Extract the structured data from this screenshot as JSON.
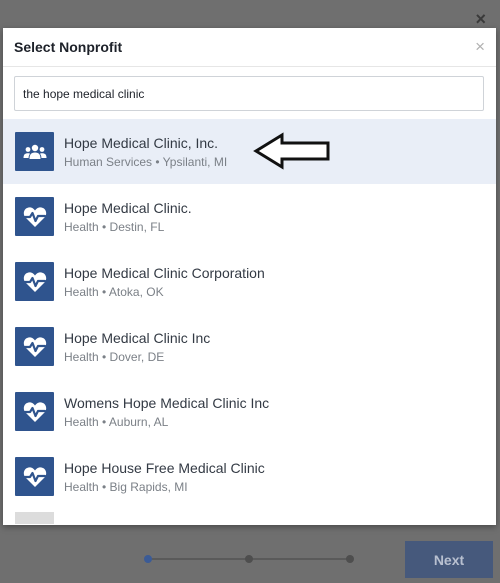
{
  "background": {
    "close_symbol": "×"
  },
  "modal": {
    "title": "Select Nonprofit",
    "close_symbol": "×",
    "search": {
      "value": "the hope medical clinic",
      "placeholder": ""
    },
    "results": [
      {
        "name": "Hope Medical Clinic, Inc.",
        "subtitle": "Human Services • Ypsilanti, MI",
        "icon": "people-icon",
        "selected": true
      },
      {
        "name": "Hope Medical Clinic.",
        "subtitle": "Health • Destin, FL",
        "icon": "heart-pulse-icon",
        "selected": false
      },
      {
        "name": "Hope Medical Clinic Corporation",
        "subtitle": "Health • Atoka, OK",
        "icon": "heart-pulse-icon",
        "selected": false
      },
      {
        "name": "Hope Medical Clinic Inc",
        "subtitle": "Health • Dover, DE",
        "icon": "heart-pulse-icon",
        "selected": false
      },
      {
        "name": "Womens Hope Medical Clinic Inc",
        "subtitle": "Health • Auburn, AL",
        "icon": "heart-pulse-icon",
        "selected": false
      },
      {
        "name": "Hope House Free Medical Clinic",
        "subtitle": "Health • Big Rapids, MI",
        "icon": "heart-pulse-icon",
        "selected": false
      }
    ]
  },
  "footer": {
    "next_label": "Next",
    "steps_total": 3,
    "current_step": 1
  },
  "colors": {
    "icon_bg": "#2f548e",
    "selected_row_bg": "#e9eef7",
    "overlay": "#6f6f6f",
    "next_button": "#46597c"
  }
}
